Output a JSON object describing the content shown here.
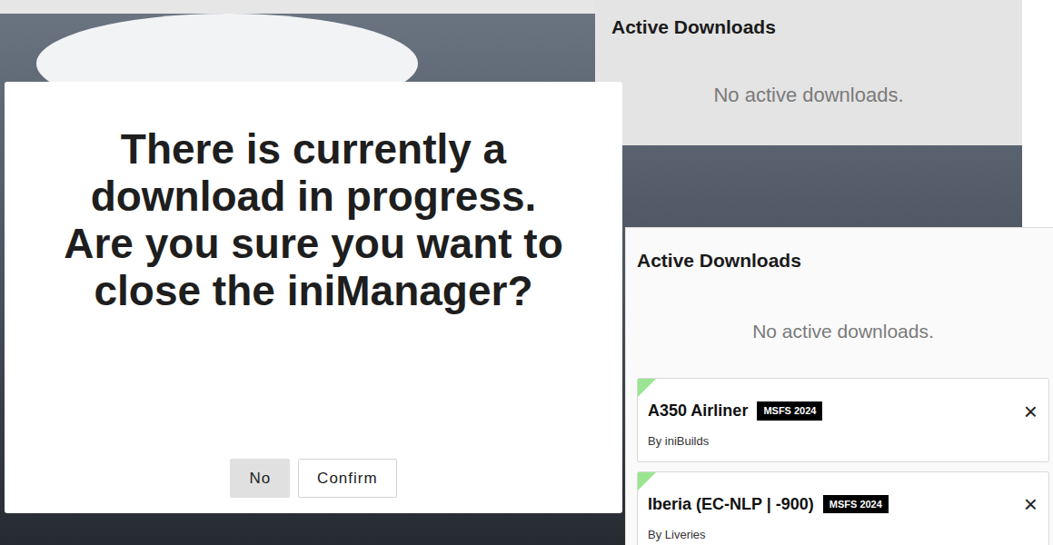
{
  "modal": {
    "message": "There is currently a download in progress. Are you sure you want to close the iniManager?",
    "buttons": [
      {
        "label": "No",
        "highlighted": true
      },
      {
        "label": "Confirm",
        "highlighted": false
      }
    ]
  },
  "background_panel": {
    "title": "Active Downloads",
    "empty_text": "No active downloads."
  },
  "downloads_panel": {
    "title": "Active Downloads",
    "empty_text": "No active downloads.",
    "items": [
      {
        "name": "A350 Airliner",
        "platform": "MSFS 2024",
        "author": "By iniBuilds",
        "close": "×"
      },
      {
        "name": "Iberia (EC-NLP | -900)",
        "platform": "MSFS 2024",
        "author": "By Liveries",
        "close": "×"
      }
    ]
  }
}
